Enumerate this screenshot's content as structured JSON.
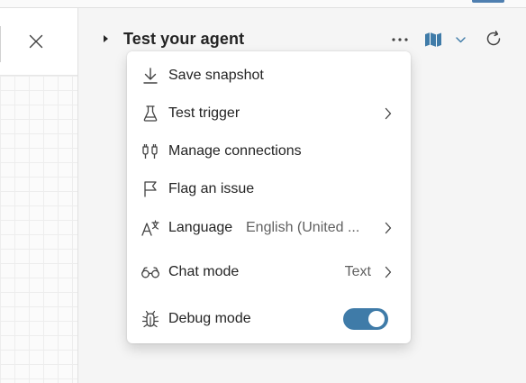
{
  "pane": {
    "title": "Test your agent"
  },
  "menu": {
    "items": [
      {
        "id": "save-snapshot",
        "label": "Save snapshot",
        "icon": "download-icon"
      },
      {
        "id": "test-trigger",
        "label": "Test trigger",
        "icon": "beaker-icon",
        "submenu": true
      },
      {
        "id": "manage-connections",
        "label": "Manage connections",
        "icon": "plug-connected-icon"
      },
      {
        "id": "flag-issue",
        "label": "Flag an issue",
        "icon": "flag-icon"
      },
      {
        "id": "language",
        "label": "Language",
        "value": "English (United ...",
        "icon": "translate-icon",
        "submenu": true
      },
      {
        "id": "chat-mode",
        "label": "Chat mode",
        "value": "Text",
        "icon": "glasses-icon",
        "submenu": true
      },
      {
        "id": "debug-mode",
        "label": "Debug mode",
        "icon": "bug-icon",
        "toggle_on": true
      }
    ]
  },
  "colors": {
    "toggle_on": "#3f7ba8",
    "accent_blue": "#4f7fb0",
    "text": "#242424",
    "muted_text": "#616161"
  }
}
